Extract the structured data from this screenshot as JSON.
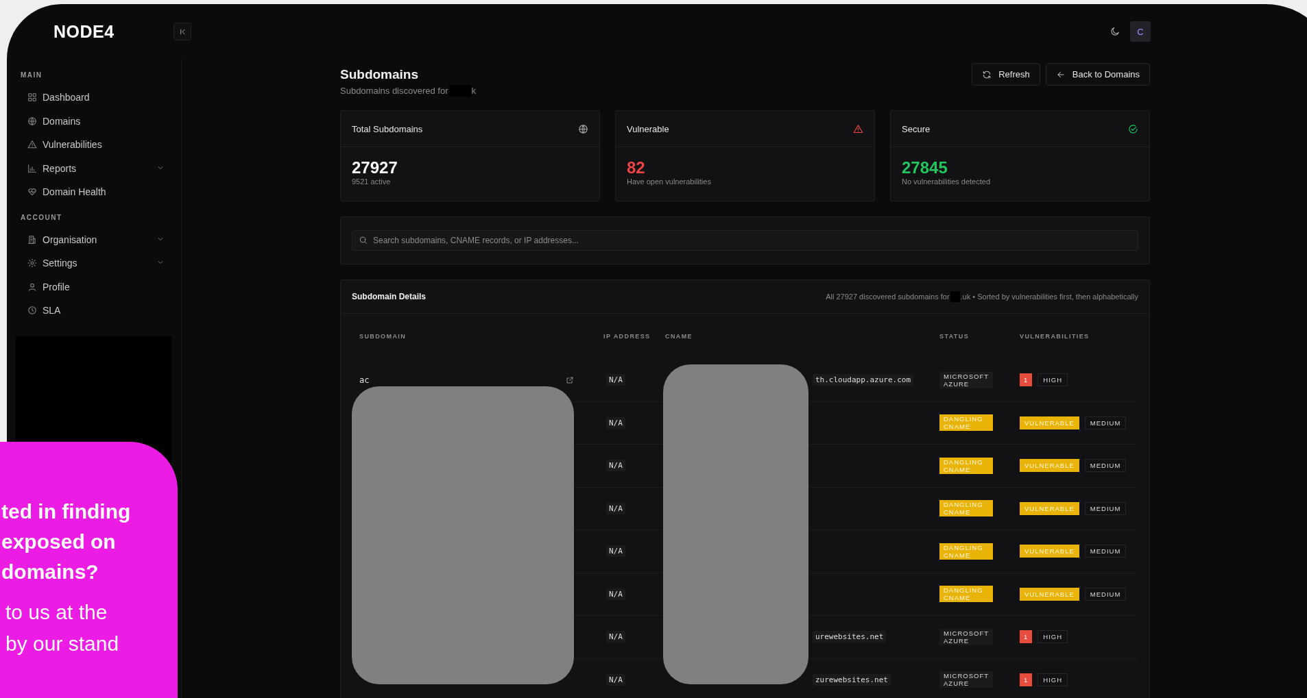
{
  "topbar": {
    "logo": "NODE4",
    "avatar": "C"
  },
  "sidebar": {
    "sections": [
      {
        "label": "MAIN",
        "items": [
          {
            "label": "Dashboard"
          },
          {
            "label": "Domains"
          },
          {
            "label": "Vulnerabilities"
          },
          {
            "label": "Reports",
            "expanded": false
          },
          {
            "label": "Domain Health"
          }
        ]
      },
      {
        "label": "ACCOUNT",
        "items": [
          {
            "label": "Organisation",
            "expanded": false
          },
          {
            "label": "Settings",
            "expanded": false
          },
          {
            "label": "Profile"
          },
          {
            "label": "SLA"
          }
        ]
      }
    ]
  },
  "page": {
    "title": "Subdomains",
    "subtitle_start": "Subdomains discovered for",
    "subtitle_end": "k",
    "buttons": [
      {
        "label": "Refresh"
      },
      {
        "label": "Back to Domains"
      }
    ]
  },
  "stats": [
    {
      "kind": "total",
      "title": "Total Subdomains",
      "value": "27927",
      "note": "9521 active",
      "color": "#ffffff"
    },
    {
      "kind": "vulnerable",
      "title": "Vulnerable",
      "value": "82",
      "note": "Have open vulnerabilities",
      "color": "#ef4444"
    },
    {
      "kind": "secure",
      "title": "Secure",
      "value": "27845",
      "note": "No vulnerabilities detected",
      "color": "#22c55e"
    }
  ],
  "search": {
    "placeholder": "Search subdomains, CNAME records, or IP addresses..."
  },
  "details": {
    "title": "Subdomain Details",
    "summary_start": "All 27927 discovered subdomains for",
    "summary_end": ".uk • Sorted by vulnerabilities first, then alphabetically",
    "columns": [
      "SUBDOMAIN",
      "IP ADDRESS",
      "CNAME",
      "STATUS",
      "VULNERABILITIES"
    ],
    "rows": [
      {
        "subdomain": "ac",
        "ip": "N/A",
        "cname": "th.cloudapp.azure.com",
        "status": {
          "kind": "provider",
          "label": "MICROSOFT AZURE"
        },
        "vuln": {
          "kind": "count",
          "badge": "1",
          "severity": "HIGH"
        }
      },
      {
        "ip": "N/A",
        "status": {
          "kind": "dangling",
          "label": "DANGLING CNAME"
        },
        "vuln": {
          "kind": "flag",
          "badge": "VULNERABLE",
          "severity": "MEDIUM"
        }
      },
      {
        "ip": "N/A",
        "status": {
          "kind": "dangling",
          "label": "DANGLING CNAME"
        },
        "vuln": {
          "kind": "flag",
          "badge": "VULNERABLE",
          "severity": "MEDIUM"
        }
      },
      {
        "ip": "N/A",
        "status": {
          "kind": "dangling",
          "label": "DANGLING CNAME"
        },
        "vuln": {
          "kind": "flag",
          "badge": "VULNERABLE",
          "severity": "MEDIUM"
        }
      },
      {
        "ip": "N/A",
        "status": {
          "kind": "dangling",
          "label": "DANGLING CNAME"
        },
        "vuln": {
          "kind": "flag",
          "badge": "VULNERABLE",
          "severity": "MEDIUM"
        }
      },
      {
        "ip": "N/A",
        "status": {
          "kind": "dangling",
          "label": "DANGLING CNAME"
        },
        "vuln": {
          "kind": "flag",
          "badge": "VULNERABLE",
          "severity": "MEDIUM"
        }
      },
      {
        "ip": "N/A",
        "cname": "urewebsites.net",
        "status": {
          "kind": "provider",
          "label": "MICROSOFT AZURE"
        },
        "vuln": {
          "kind": "count",
          "badge": "1",
          "severity": "HIGH"
        }
      },
      {
        "ip": "N/A",
        "cname": "zurewebsites.net",
        "status": {
          "kind": "provider",
          "label": "MICROSOFT AZURE"
        },
        "vuln": {
          "kind": "count",
          "badge": "1",
          "severity": "HIGH"
        }
      }
    ]
  },
  "promo": {
    "heading_lines": [
      "ted in finding",
      "exposed on",
      "domains?"
    ],
    "body_lines": [
      "to us at the",
      "by our stand"
    ]
  }
}
